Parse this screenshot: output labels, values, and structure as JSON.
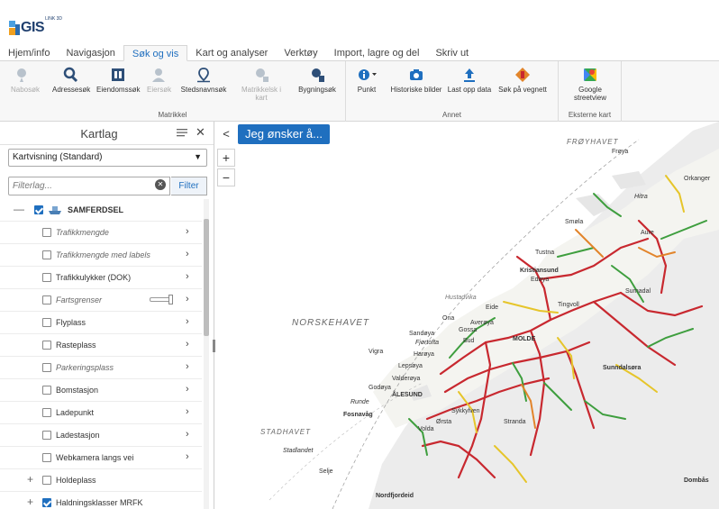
{
  "app": {
    "logo_text": "GIS",
    "logo_sup": "LINK 3D"
  },
  "tabs": [
    {
      "label": "Hjem/info",
      "active": false
    },
    {
      "label": "Navigasjon",
      "active": false
    },
    {
      "label": "Søk og vis",
      "active": true
    },
    {
      "label": "Kart og analyser",
      "active": false
    },
    {
      "label": "Verktøy",
      "active": false
    },
    {
      "label": "Import, lagre og del",
      "active": false
    },
    {
      "label": "Skriv ut",
      "active": false
    }
  ],
  "ribbon": {
    "groups": {
      "matrikkel": "Matrikkel",
      "annet": "Annet",
      "eksterne": "Eksterne kart"
    },
    "buttons": {
      "nabosok": "Nabosøk",
      "adressesok": "Adressesøk",
      "eiendomssok": "Eiendomssøk",
      "eiersok": "Eiersøk",
      "stedsnavnsok": "Stedsnavnsøk",
      "matrikkelskart": "Matrikkelsk i kart",
      "bygningsok": "Bygningsøk",
      "punkt": "Punkt",
      "historiske": "Historiske bilder",
      "lastopp": "Last opp data",
      "sokvegnett": "Søk på vegnett",
      "google": "Google streetview"
    }
  },
  "panel": {
    "title": "Kartlag",
    "select_value": "Kartvisning (Standard)",
    "filter_placeholder": "Filterlag...",
    "filter_button": "Filter",
    "top_group": "SAMFERDSEL",
    "layers": [
      {
        "label": "Trafikkmengde",
        "italic": true,
        "checked": false
      },
      {
        "label": "Trafikkmengde med labels",
        "italic": true,
        "checked": false
      },
      {
        "label": "Trafikkulykker (DOK)",
        "italic": false,
        "checked": false
      },
      {
        "label": "Fartsgrenser",
        "italic": true,
        "checked": false
      },
      {
        "label": "Flyplass",
        "italic": false,
        "checked": false
      },
      {
        "label": "Rasteplass",
        "italic": false,
        "checked": false
      },
      {
        "label": "Parkeringsplass",
        "italic": true,
        "checked": false
      },
      {
        "label": "Bomstasjon",
        "italic": false,
        "checked": false
      },
      {
        "label": "Ladepunkt",
        "italic": false,
        "checked": false
      },
      {
        "label": "Ladestasjon",
        "italic": false,
        "checked": false
      },
      {
        "label": "Webkamera langs vei",
        "italic": false,
        "checked": false
      }
    ],
    "sub_groups": [
      {
        "label": "Holdeplass",
        "checked": false
      },
      {
        "label": "Haldningsklasser MRFK",
        "checked": true
      }
    ]
  },
  "map": {
    "wish_button": "Jeg ønsker å...",
    "zoom_in": "+",
    "zoom_out": "−",
    "collapse": "<",
    "sea_labels": {
      "norskehavet": "NORSKEHAVET",
      "stadhavet": "STADHAVET",
      "froyhavet": "FRØYHAVET"
    },
    "place_labels": [
      "Kristiansund",
      "MOLDE",
      "ÅLESUND",
      "Hustadvika",
      "Smøla",
      "Frøya",
      "Hitra",
      "Averøya",
      "Harøya",
      "Fjørtofta",
      "Lepsøya",
      "Valderøya",
      "Godøya",
      "Runde",
      "Fosnavåg",
      "Ørsta",
      "Volda",
      "Stranda",
      "Sunndalsøra",
      "Surnadal",
      "Aure",
      "Tingvoll",
      "Eide",
      "Sykkylven",
      "Vigra",
      "Dombås",
      "Nordfjordeid",
      "Stadlandet",
      "Selje",
      "Orkanger",
      "Bud",
      "Ona",
      "Sandøya",
      "Gossa",
      "Tustna",
      "Edøya"
    ]
  },
  "colors": {
    "accent": "#1f6fbf",
    "road_red": "#c8282f",
    "road_green": "#3e9e3e",
    "road_yellow": "#e6c52a",
    "road_orange": "#e2842a",
    "land": "#ececec"
  }
}
